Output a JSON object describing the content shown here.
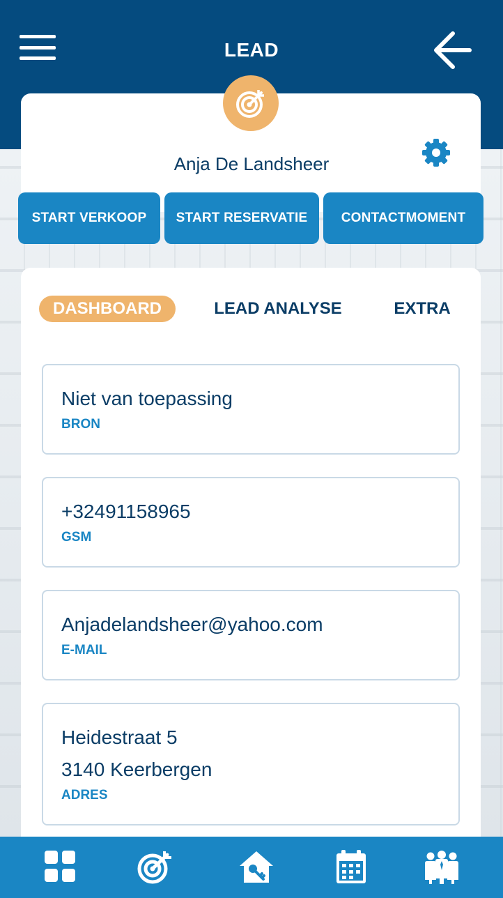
{
  "header": {
    "title": "LEAD",
    "menu_icon": "hamburger-menu-icon",
    "back_icon": "arrow-left-icon"
  },
  "profile": {
    "name": "Anja De Landsheer",
    "avatar_icon": "target-icon",
    "settings_icon": "gear-icon"
  },
  "actions": {
    "start_verkoop": "START VERKOOP",
    "start_reservatie": "START RESERVATIE",
    "contactmoment": "CONTACTMOMENT"
  },
  "tabs": [
    {
      "label": "DASHBOARD",
      "active": true
    },
    {
      "label": "LEAD ANALYSE",
      "active": false
    },
    {
      "label": "EXTRA",
      "active": false
    }
  ],
  "fields": {
    "bron": {
      "value": "Niet van toepassing",
      "label": "BRON"
    },
    "gsm": {
      "value": "+32491158965",
      "label": "GSM"
    },
    "email": {
      "value": "Anjadelandsheer@yahoo.com",
      "label": "E-MAIL"
    },
    "adres": {
      "line1": "Heidestraat 5",
      "line2": "3140 Keerbergen",
      "label": "ADRES"
    }
  },
  "bottom_nav": [
    {
      "icon": "grid-icon"
    },
    {
      "icon": "target-icon"
    },
    {
      "icon": "house-key-icon"
    },
    {
      "icon": "calendar-icon"
    },
    {
      "icon": "people-icon"
    }
  ],
  "colors": {
    "header_bg": "#054b7f",
    "accent_blue": "#1a86c4",
    "accent_orange": "#efb46c",
    "text_dark": "#0b3d66"
  }
}
